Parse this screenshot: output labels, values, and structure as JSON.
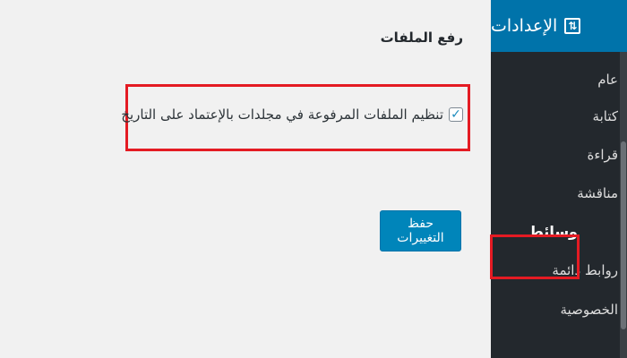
{
  "sidebar": {
    "header": {
      "title": "الإعدادات",
      "icon": "settings-sliders-icon",
      "color": "#0073aa"
    },
    "background": "#23282d",
    "items": [
      {
        "label": "عام"
      },
      {
        "label": "كتابة"
      },
      {
        "label": "قراءة"
      },
      {
        "label": "مناقشة"
      },
      {
        "label": "وسائط",
        "active": true
      },
      {
        "label": "روابط دائمة"
      },
      {
        "label": "الخصوصية"
      }
    ]
  },
  "main": {
    "section_title": "رفع الملفات",
    "organize_uploads": {
      "label": "تنظيم الملفات المرفوعة في مجلدات بالإعتماد على التاريخ",
      "checked": true
    },
    "save_label": "حفظ التغييرات"
  },
  "colors": {
    "highlight": "#e41b23",
    "button": "#0085ba"
  }
}
